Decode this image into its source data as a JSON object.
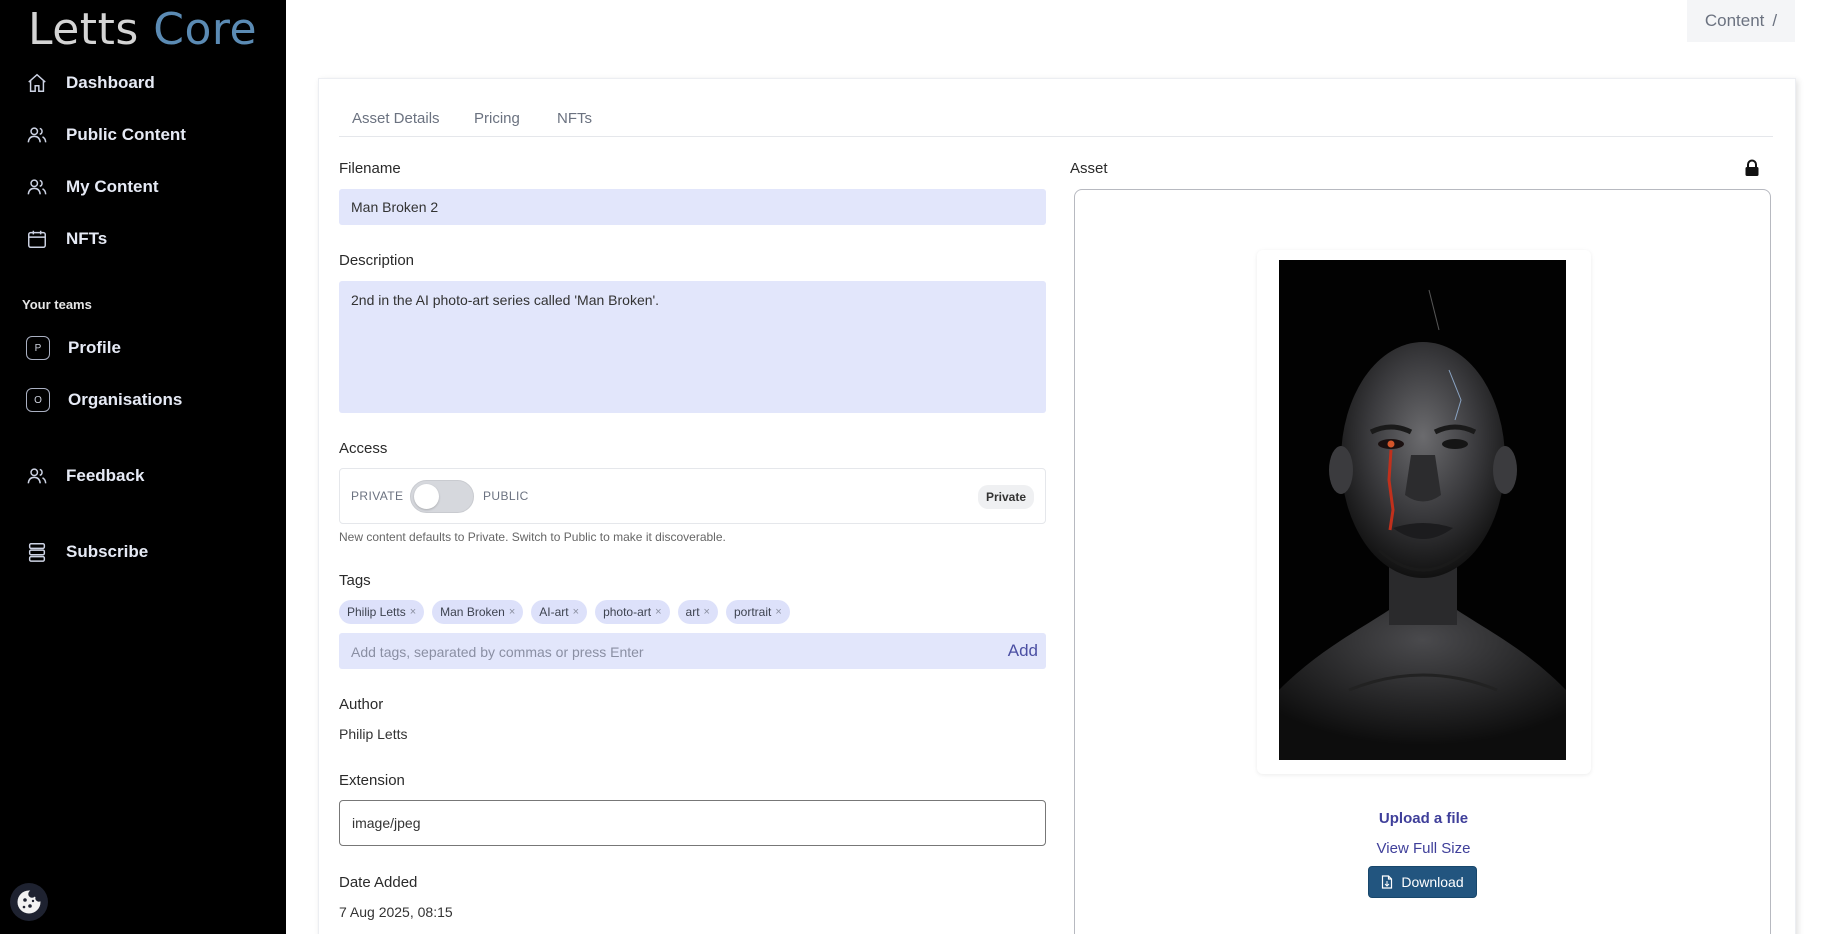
{
  "app": {
    "logo_part1": "Letts",
    "logo_part2": "Core"
  },
  "sidebar": {
    "items": [
      {
        "label": "Dashboard",
        "icon": "home-icon"
      },
      {
        "label": "Public Content",
        "icon": "users-icon"
      },
      {
        "label": "My Content",
        "icon": "users-icon"
      },
      {
        "label": "NFTs",
        "icon": "calendar-icon"
      }
    ],
    "teams_title": "Your teams",
    "teams": [
      {
        "initial": "P",
        "label": "Profile"
      },
      {
        "initial": "O",
        "label": "Organisations"
      }
    ],
    "feedback": "Feedback",
    "subscribe": "Subscribe"
  },
  "breadcrumb": {
    "text": "Content",
    "separator": "/"
  },
  "tabs": [
    "Asset Details",
    "Pricing",
    "NFTs"
  ],
  "form": {
    "filename_label": "Filename",
    "filename_value": "Man Broken 2",
    "description_label": "Description",
    "description_value": "2nd in the AI photo-art series called 'Man Broken'.",
    "access_label": "Access",
    "access_private": "PRIVATE",
    "access_public": "PUBLIC",
    "access_badge": "Private",
    "access_hint": "New content defaults to Private. Switch to Public to make it discoverable.",
    "tags_label": "Tags",
    "tags": [
      "Philip Letts",
      "Man Broken",
      "AI-art",
      "photo-art",
      "art",
      "portrait"
    ],
    "tag_remove": "×",
    "tag_placeholder": "Add tags, separated by commas or press Enter",
    "tag_add": "Add",
    "author_label": "Author",
    "author_value": "Philip Letts",
    "extension_label": "Extension",
    "extension_value": "image/jpeg",
    "date_label": "Date Added",
    "date_value": "7 Aug 2025, 08:15"
  },
  "asset": {
    "label": "Asset",
    "upload": "Upload a file",
    "view_full": "View Full Size",
    "download": "Download"
  },
  "colors": {
    "sidebar_bg": "#000000",
    "input_bg": "#e2e6fb",
    "accent": "#22557f",
    "link": "#3f3f9a"
  }
}
